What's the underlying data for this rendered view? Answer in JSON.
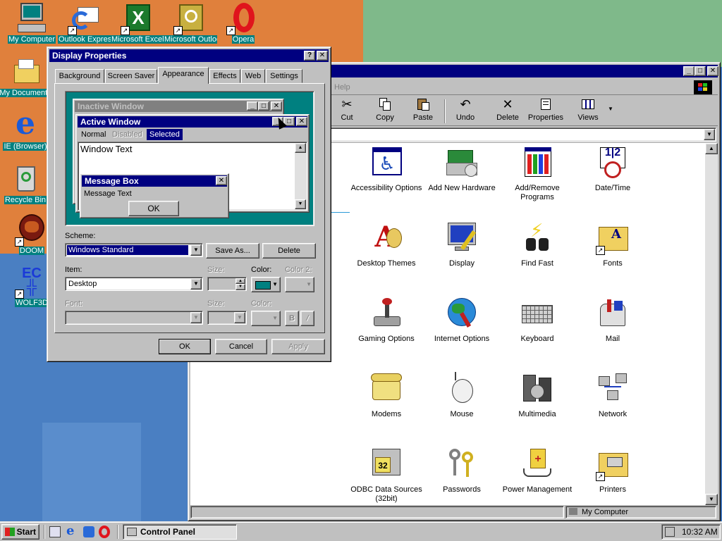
{
  "desktop_icons": [
    {
      "label": "My Computer",
      "icon": "my-computer-icon"
    },
    {
      "label": "Outlook Express",
      "icon": "outlook-express-icon"
    },
    {
      "label": "Microsoft Excel",
      "icon": "excel-icon"
    },
    {
      "label": "Microsoft Outlook",
      "icon": "outlook-icon"
    },
    {
      "label": "Opera",
      "icon": "opera-icon"
    },
    {
      "label": "My Documents",
      "icon": "folder-icon"
    },
    {
      "label": "IE (Browser)",
      "icon": "internet-explorer-icon"
    },
    {
      "label": "Recycle Bin",
      "icon": "recycle-bin-icon"
    },
    {
      "label": "DOOM",
      "icon": "doom-icon"
    },
    {
      "label": "WOLF3D",
      "icon": "wolf3d-icon"
    }
  ],
  "control_panel": {
    "menu_help": "Help",
    "toolbar": [
      "Cut",
      "Copy",
      "Paste",
      "Undo",
      "Delete",
      "Properties",
      "Views"
    ],
    "items": [
      "Accessibility Options",
      "Add New Hardware",
      "Add/Remove Programs",
      "Date/Time",
      "Desktop Themes",
      "Display",
      "Find Fast",
      "Fonts",
      "Gaming Options",
      "Internet Options",
      "Keyboard",
      "Mail",
      "Modems",
      "Mouse",
      "Multimedia",
      "Network",
      "ODBC Data Sources (32bit)",
      "Passwords",
      "Power Management",
      "Printers"
    ],
    "status_location": "My Computer"
  },
  "display_properties": {
    "title": "Display Properties",
    "tabs": [
      "Background",
      "Screen Saver",
      "Appearance",
      "Effects",
      "Web",
      "Settings"
    ],
    "selected_tab": "Appearance",
    "preview": {
      "inactive_title": "Inactive Window",
      "active_title": "Active Window",
      "menu_normal": "Normal",
      "menu_disabled": "Disabled",
      "menu_selected": "Selected",
      "window_text": "Window Text",
      "msgbox_title": "Message Box",
      "msgbox_text": "Message Text",
      "msgbox_ok": "OK"
    },
    "scheme_label": "Scheme:",
    "scheme_value": "Windows Standard",
    "save_as": "Save As...",
    "delete": "Delete",
    "item_label": "Item:",
    "item_value": "Desktop",
    "size_label": "Size:",
    "color_label": "Color:",
    "color2_label": "Color 2:",
    "font_label": "Font:",
    "font_size_label": "Size:",
    "font_color_label": "Color:",
    "bold_label": "B",
    "italic_label": "/",
    "ok": "OK",
    "cancel": "Cancel",
    "apply": "Apply",
    "desktop_color": "#008080"
  },
  "taskbar": {
    "start": "Start",
    "task": "Control Panel",
    "clock": "10:32 AM"
  }
}
